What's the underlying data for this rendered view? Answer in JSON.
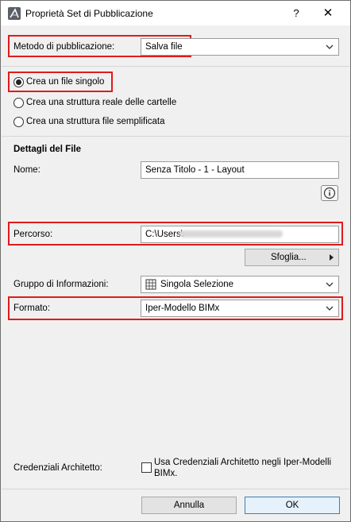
{
  "window": {
    "title": "Proprietà Set di Pubblicazione",
    "help_label": "?",
    "close_label": "✕"
  },
  "method": {
    "label": "Metodo di pubblicazione:",
    "value": "Salva file"
  },
  "structure": {
    "options": [
      {
        "label": "Crea un file singolo",
        "selected": true
      },
      {
        "label": "Crea una struttura reale delle cartelle",
        "selected": false
      },
      {
        "label": "Crea una struttura file semplificata",
        "selected": false
      }
    ]
  },
  "file_details": {
    "heading": "Dettagli del File",
    "name_label": "Nome:",
    "name_value": "Senza Titolo - 1 - Layout",
    "path_label": "Percorso:",
    "path_value": "C:\\Users\\",
    "browse_label": "Sfoglia..."
  },
  "info_group": {
    "label": "Gruppo di Informazioni:",
    "value": "Singola Selezione"
  },
  "format": {
    "label": "Formato:",
    "value": "Iper-Modello BIMx"
  },
  "credentials": {
    "label": "Credenziali Architetto:",
    "checkbox_line1": "Usa Credenziali Architetto negli Iper-Modelli",
    "checkbox_line2": "BIMx.",
    "checked": false
  },
  "footer": {
    "cancel_label": "Annulla",
    "ok_label": "OK"
  },
  "colors": {
    "highlight": "#e01b1b",
    "ok_border": "#3c7fb1"
  }
}
